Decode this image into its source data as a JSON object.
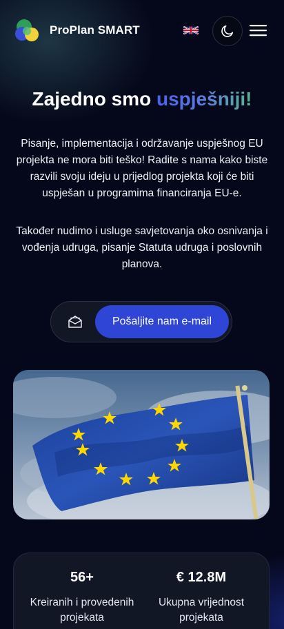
{
  "brand": {
    "name": "ProPlan SMART"
  },
  "header": {
    "language_icon": "uk-flag-icon",
    "theme_icon": "moon-icon",
    "menu_icon": "hamburger-menu-icon"
  },
  "hero": {
    "title_main": "Zajedno smo ",
    "title_highlight": "uspješniji!",
    "paragraph1": "Pisanje, implementacija i održavanje uspješnog EU projekta ne mora biti teško! Radite s nama kako biste razvili svoju ideju u prijedlog projekta koji će biti uspješan u programima financiranja EU-e.",
    "paragraph2": "Također nudimo i usluge savjetovanja oko osnivanja i vođenja udruga, pisanje Statuta udruga i poslovnih planova.",
    "cta_label": "Pošaljite nam e-mail",
    "cta_icon": "envelope-open-icon"
  },
  "image": {
    "subject": "eu-flag-image"
  },
  "stats": [
    {
      "value": "56+",
      "label": "Kreiranih i provedenih projekata"
    },
    {
      "value": "€ 12.8M",
      "label": "Ukupna vrijednost projekata"
    }
  ],
  "colors": {
    "background": "#05081a",
    "accent": "#2f45d6",
    "highlight_start": "#4b63e8",
    "highlight_end": "#59b58c"
  }
}
